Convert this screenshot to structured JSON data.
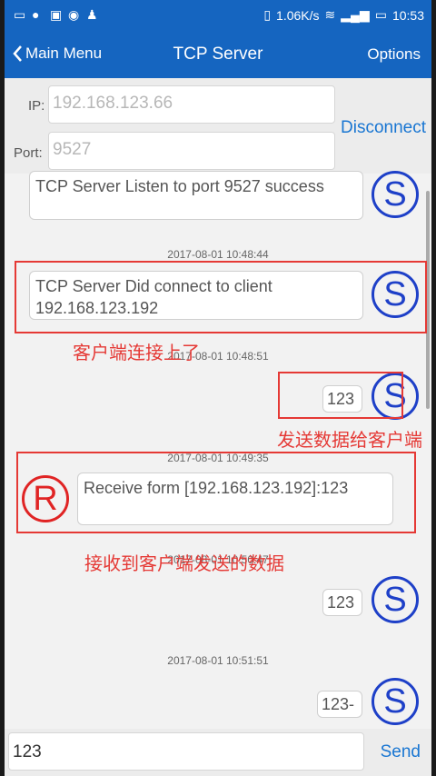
{
  "status_bar": {
    "speed": "1.06K/s",
    "time": "10:53"
  },
  "header": {
    "back_label": "Main Menu",
    "title": "TCP Server",
    "options_label": "Options"
  },
  "connection": {
    "ip_label": "IP:",
    "ip_placeholder": "192.168.123.66",
    "port_label": "Port:",
    "port_placeholder": "9527",
    "disconnect_label": "Disconnect"
  },
  "messages": [
    {
      "text": "TCP Server Listen to port 9527 success",
      "avatar": "S"
    },
    {
      "time": "2017-08-01 10:48:44",
      "text": "TCP Server Did connect to client 192.168.123.192",
      "avatar": "S"
    },
    {
      "time": "2017-08-01 10:48:51",
      "text": "123",
      "avatar": "S"
    },
    {
      "time": "2017-08-01 10:49:35",
      "text": "Receive form [192.168.123.192]:123",
      "avatar": "R"
    },
    {
      "time": "2017-08-01 10:50:47",
      "text": "123",
      "avatar": "S"
    },
    {
      "time": "2017-08-01 10:51:51",
      "text": "123-",
      "avatar": "S"
    }
  ],
  "annotations": {
    "client_connected": "客户端连接上了",
    "send_to_client": "发送数据给客户端",
    "receive_from_client": "接收到客户端发送的数据"
  },
  "input": {
    "value": "123",
    "send_label": "Send"
  },
  "colors": {
    "header_blue": "#1565c0",
    "accent_blue": "#1976d2",
    "server_avatar": "#1e40c8",
    "receive_avatar": "#e02424",
    "annotation_red": "#e53935"
  }
}
